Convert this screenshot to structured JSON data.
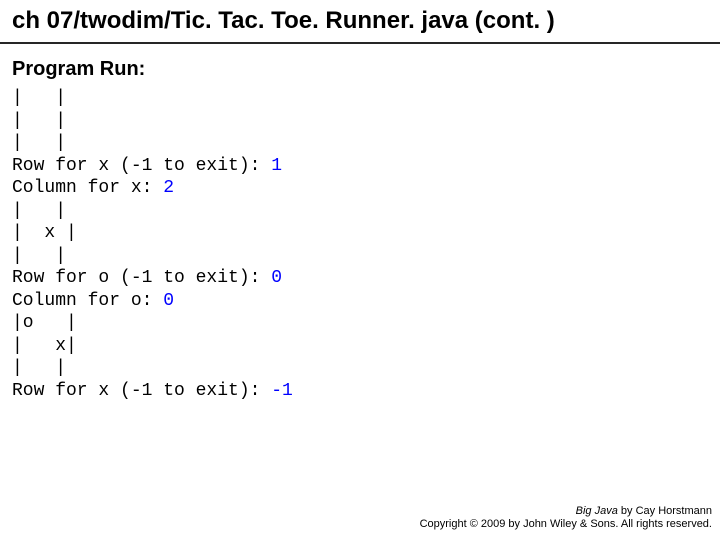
{
  "title": "ch 07/twodim/Tic. Tac. Toe. Runner. java (cont. )",
  "subtitle": "Program Run:",
  "code_lines": [
    {
      "segments": [
        {
          "t": "|   |"
        }
      ]
    },
    {
      "segments": [
        {
          "t": "|   |"
        }
      ]
    },
    {
      "segments": [
        {
          "t": "|   |"
        }
      ]
    },
    {
      "segments": [
        {
          "t": "Row for x (-1 to exit): "
        },
        {
          "t": "1",
          "c": "inp"
        }
      ]
    },
    {
      "segments": [
        {
          "t": "Column for x: "
        },
        {
          "t": "2",
          "c": "inp"
        }
      ]
    },
    {
      "segments": [
        {
          "t": "|   |"
        }
      ]
    },
    {
      "segments": [
        {
          "t": "|  x |"
        }
      ]
    },
    {
      "segments": [
        {
          "t": "|   |"
        }
      ]
    },
    {
      "segments": [
        {
          "t": "Row for o (-1 to exit): "
        },
        {
          "t": "0",
          "c": "inp"
        }
      ]
    },
    {
      "segments": [
        {
          "t": "Column for o: "
        },
        {
          "t": "0",
          "c": "inp"
        }
      ]
    },
    {
      "segments": [
        {
          "t": "|o   |"
        }
      ]
    },
    {
      "segments": [
        {
          "t": "|   x|"
        }
      ]
    },
    {
      "segments": [
        {
          "t": "|   |"
        }
      ]
    },
    {
      "segments": [
        {
          "t": "Row for x (-1 to exit): "
        },
        {
          "t": "-1",
          "c": "inp"
        }
      ]
    }
  ],
  "footer": {
    "book": "Big Java",
    "by": " by Cay Horstmann",
    "copyright": "Copyright © 2009 by John Wiley & Sons. All rights reserved."
  }
}
